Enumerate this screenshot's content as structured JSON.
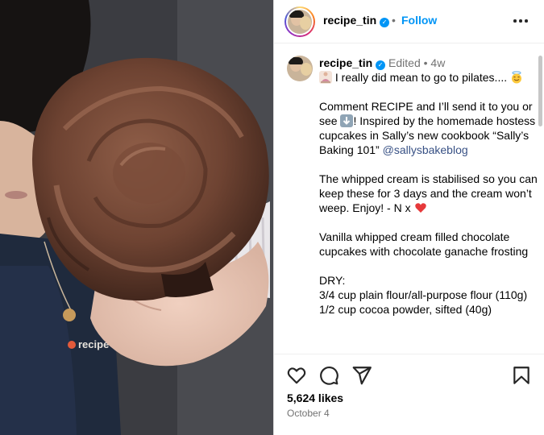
{
  "photo": {
    "apron_text": "recipe"
  },
  "header": {
    "username": "recipe_tin",
    "separator": "•",
    "follow_label": "Follow"
  },
  "caption": {
    "username": "recipe_tin",
    "edited": "Edited",
    "dot": "•",
    "age": "4w",
    "line1": " I really did mean to go to pilates....",
    "para2_a": "Comment RECIPE and I’ll send it to you or see ",
    "para2_b": "! Inspired by the homemade hostess cupcakes in Sally’s new cookbook “Sally’s Baking 101”",
    "mention": "@sallysbakeblog",
    "para3": "The whipped cream is stabilised so you can keep these for 3 days and the cream won’t weep. Enjoy! - N x ",
    "para4": "Vanilla whipped cream filled chocolate cupcakes with chocolate ganache frosting",
    "dry_heading": "DRY:",
    "dry_1": "3/4 cup plain flour/all-purpose flour (110g)",
    "dry_2": "1/2 cup cocoa powder, sifted (40g)"
  },
  "actions": {
    "likes": "5,624 likes",
    "date": "October 4"
  },
  "icons": {
    "like": "heart-icon",
    "comment": "comment-icon",
    "share": "share-icon",
    "save": "bookmark-icon",
    "more": "more-icon",
    "verified": "verified-icon",
    "down_arrow": "down-arrow-emoji",
    "heart_emoji": "red-heart-emoji",
    "halo_emoji": "smiling-face-with-halo-emoji",
    "pilates_emoji": "person-in-lotus-position-emoji"
  },
  "colors": {
    "follow": "#0095f6",
    "mention": "#385185",
    "muted": "#737373",
    "verified": "#0095f6"
  }
}
